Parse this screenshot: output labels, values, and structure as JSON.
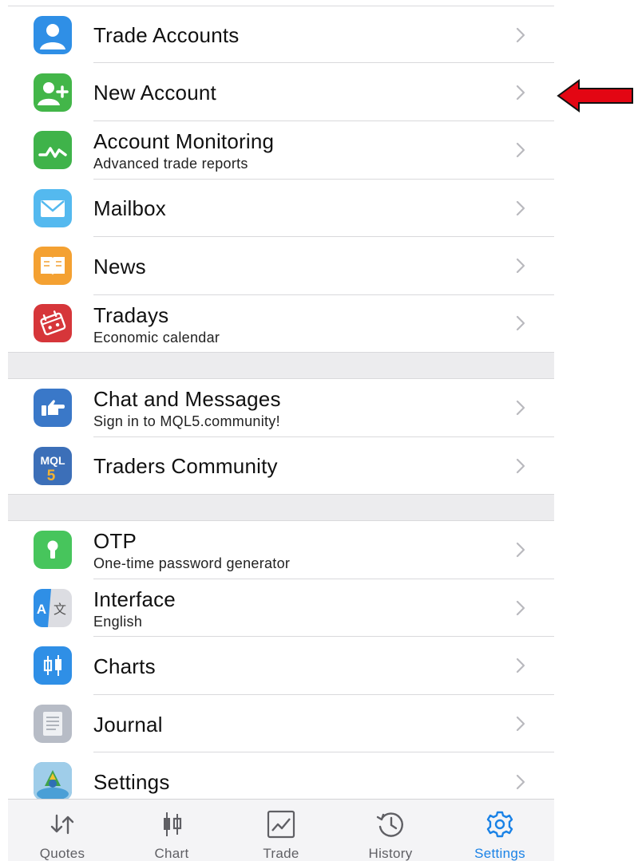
{
  "menu": {
    "group1": [
      {
        "title": "Trade Accounts",
        "subtitle": "",
        "icon": "user-icon",
        "color": "#2f8fe6"
      },
      {
        "title": "New Account",
        "subtitle": "",
        "icon": "add-user-icon",
        "color": "#43b649"
      },
      {
        "title": "Account Monitoring",
        "subtitle": "Advanced trade reports",
        "icon": "pulse-chart-icon",
        "color": "#3fb34a"
      },
      {
        "title": "Mailbox",
        "subtitle": "",
        "icon": "mail-icon",
        "color": "#54b9ef"
      },
      {
        "title": "News",
        "subtitle": "",
        "icon": "book-icon",
        "color": "#f4a132"
      },
      {
        "title": "Tradays",
        "subtitle": "Economic calendar",
        "icon": "calendar-icon",
        "color": "#d6363a"
      }
    ],
    "group2": [
      {
        "title": "Chat and Messages",
        "subtitle": "Sign in to MQL5.community!",
        "icon": "thumb-pointing-icon",
        "color": "#3a78c8"
      },
      {
        "title": "Traders Community",
        "subtitle": "",
        "icon": "mql5-icon",
        "color": "#3c6fb8"
      }
    ],
    "group3": [
      {
        "title": "OTP",
        "subtitle": "One-time password generator",
        "icon": "key-icon",
        "color": "#47c55c"
      },
      {
        "title": "Interface",
        "subtitle": "English",
        "icon": "translate-icon",
        "color": "#2f8fe6"
      },
      {
        "title": "Charts",
        "subtitle": "",
        "icon": "candlestick-icon",
        "color": "#2f8fe6"
      },
      {
        "title": "Journal",
        "subtitle": "",
        "icon": "document-icon",
        "color": "#b7bcc6"
      },
      {
        "title": "Settings",
        "subtitle": "",
        "icon": "metatrader-icon",
        "color": "#6aa7d9"
      }
    ]
  },
  "tabbar": {
    "tabs": [
      {
        "label": "Quotes",
        "icon": "quotes-arrows-icon",
        "active": false
      },
      {
        "label": "Chart",
        "icon": "chart-candles-icon",
        "active": false
      },
      {
        "label": "Trade",
        "icon": "trade-chart-icon",
        "active": false
      },
      {
        "label": "History",
        "icon": "history-icon",
        "active": false
      },
      {
        "label": "Settings",
        "icon": "gear-icon",
        "active": true
      }
    ],
    "active_color": "#1a82e6",
    "inactive_color": "#5f5f64"
  },
  "annotation": {
    "icon": "red-arrow-icon",
    "color": "#e30613"
  }
}
